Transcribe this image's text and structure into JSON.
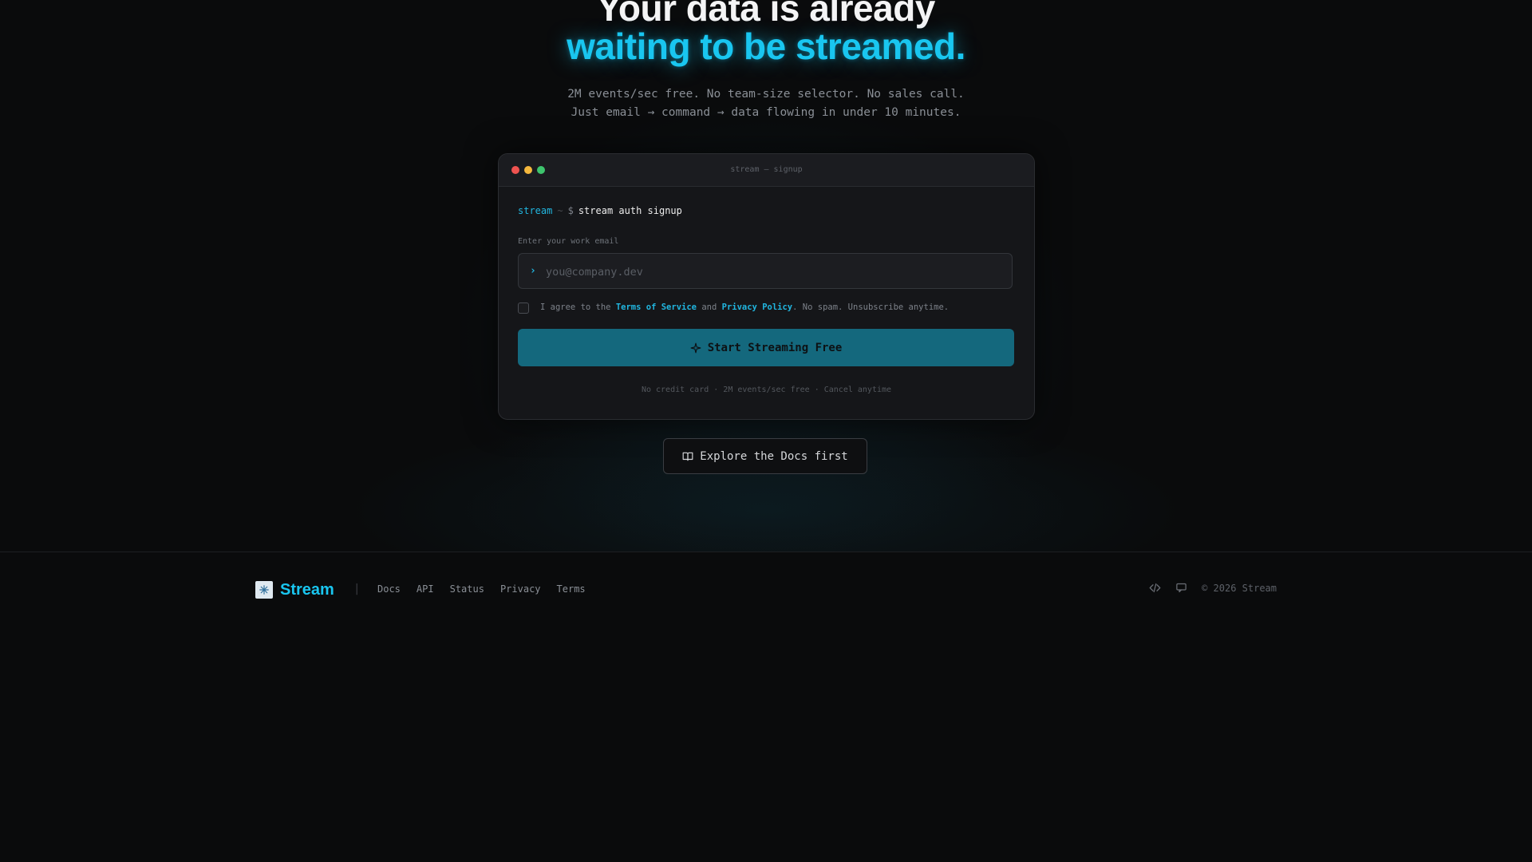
{
  "hero": {
    "headline_line1": "Your data is already",
    "headline_line2": "waiting to be streamed.",
    "subtitle_line1": "2M events/sec free. No team-size selector. No sales call.",
    "subtitle_line2": "Just email → command → data flowing in under 10 minutes."
  },
  "terminal": {
    "window_title": "stream — signup",
    "prompt_dir": "stream",
    "prompt_arrow": "~",
    "prompt_symbol": "$",
    "command": "stream auth signup",
    "email_label": "Enter your work email",
    "email_prompt_glyph": "›",
    "email_placeholder": "you@company.dev",
    "email_value": "",
    "agree_prefix": "I agree to the",
    "terms_link": "Terms of Service",
    "agree_and": "and",
    "privacy_link": "Privacy Policy",
    "agree_suffix": ". No spam. Unsubscribe anytime.",
    "agree_checked": false,
    "cta_label": "Start Streaming Free",
    "fineprint": "No credit card · 2M events/sec free · Cancel anytime"
  },
  "docs_button": {
    "label": "Explore the Docs first",
    "icon": "book-open-icon"
  },
  "footer": {
    "brand_name": "Stream",
    "separator": "|",
    "nav": [
      "Docs",
      "API",
      "Status",
      "Privacy",
      "Terms"
    ],
    "icons": [
      "code-icon",
      "chat-icon"
    ],
    "copyright": "© 2026 Stream"
  },
  "colors": {
    "accent": "#19c6f0",
    "cta_background": "#14687d",
    "background": "#0a0b0c"
  }
}
